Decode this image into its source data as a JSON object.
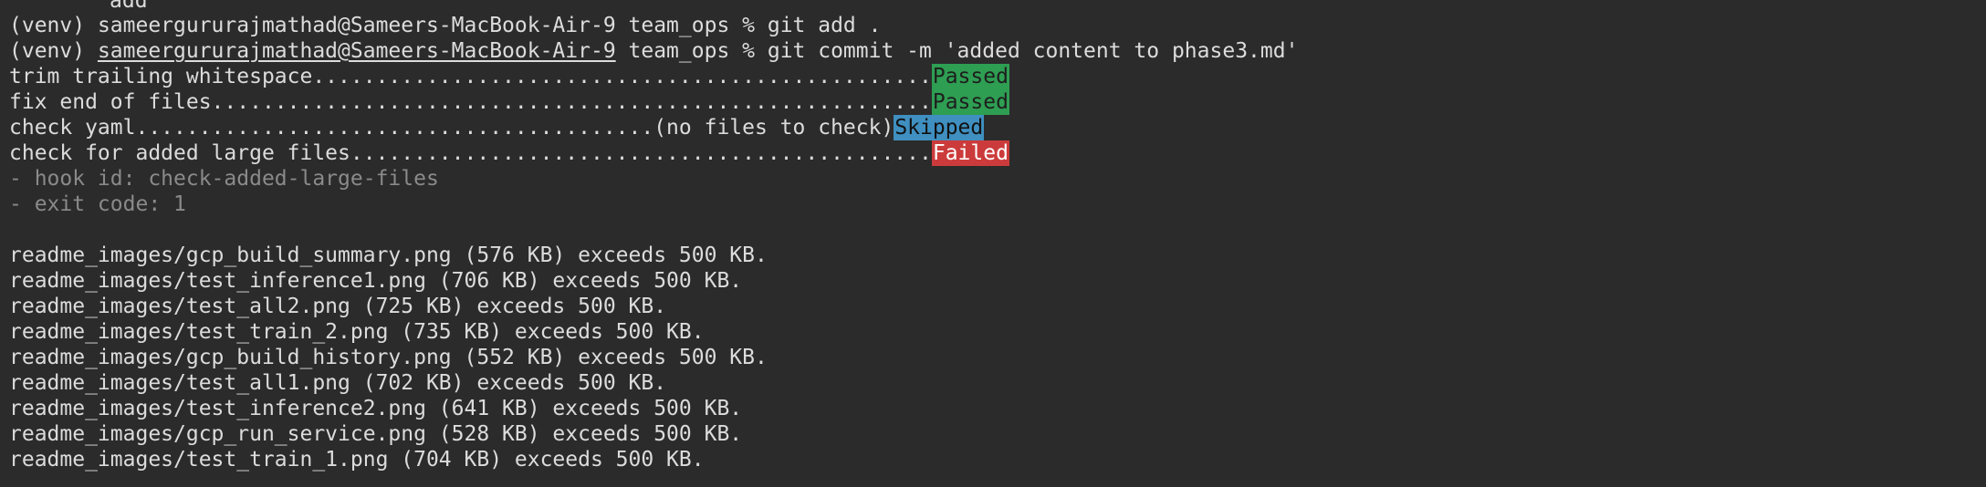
{
  "terminal": {
    "top_fragment": "add",
    "prompt_prefix": "(venv) ",
    "prompt_user_host": "sameergururajmathad@Sameers-MacBook-Air-9",
    "prompt_cwd": " team_ops % ",
    "command_1": "git add .",
    "command_2": "git commit -m 'added content to phase3.md'",
    "hooks": [
      {
        "label": "trim trailing whitespace.................................................",
        "status": "Passed",
        "status_type": "passed"
      },
      {
        "label": "fix end of files.........................................................",
        "status": "Passed",
        "status_type": "passed"
      },
      {
        "label": "check yaml.........................................(no files to check)",
        "status": "Skipped",
        "status_type": "skipped"
      },
      {
        "label": "check for added large files..............................................",
        "status": "Failed",
        "status_type": "failed"
      }
    ],
    "hook_id_line": "- hook id: check-added-large-files",
    "exit_code_line": "- exit code: 1",
    "output_lines": [
      "readme_images/gcp_build_summary.png (576 KB) exceeds 500 KB.",
      "readme_images/test_inference1.png (706 KB) exceeds 500 KB.",
      "readme_images/test_all2.png (725 KB) exceeds 500 KB.",
      "readme_images/test_train_2.png (735 KB) exceeds 500 KB.",
      "readme_images/gcp_build_history.png (552 KB) exceeds 500 KB.",
      "readme_images/test_all1.png (702 KB) exceeds 500 KB.",
      "readme_images/test_inference2.png (641 KB) exceeds 500 KB.",
      "readme_images/gcp_run_service.png (528 KB) exceeds 500 KB.",
      "readme_images/test_train_1.png (704 KB) exceeds 500 KB."
    ],
    "colors": {
      "background": "#2b2b2b",
      "text": "#dcdcdc",
      "dim_text": "#8a8a8a",
      "passed": "#2e9e52",
      "skipped": "#3f8fc0",
      "failed": "#cc3b3b"
    }
  }
}
